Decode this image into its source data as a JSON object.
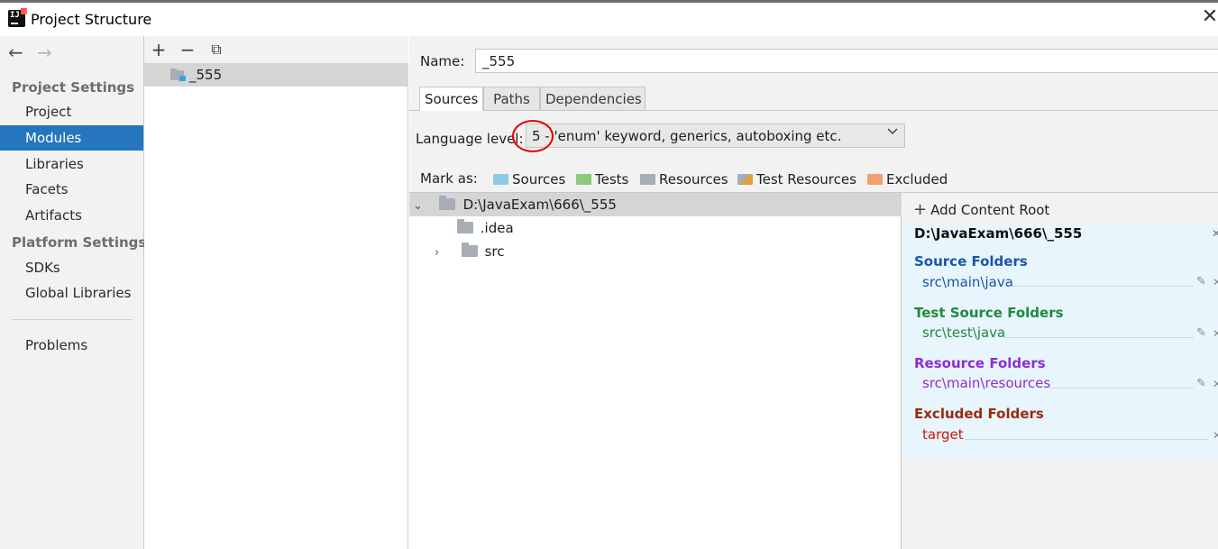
{
  "window": {
    "title": "Project Structure",
    "close_glyph": "✕"
  },
  "nav": {
    "back_glyph": "←",
    "forward_glyph": "→",
    "project_settings_header": "Project Settings",
    "project_settings_items": [
      "Project",
      "Modules",
      "Libraries",
      "Facets",
      "Artifacts"
    ],
    "platform_settings_header": "Platform Settings",
    "platform_settings_items": [
      "SDKs",
      "Global Libraries"
    ],
    "problems": "Problems",
    "selected": "Modules"
  },
  "modules": {
    "toolbar": {
      "add": "+",
      "remove": "−",
      "copy": "⧉"
    },
    "items": [
      "_555"
    ]
  },
  "module_detail": {
    "name_label": "Name:",
    "name_value": "_555",
    "tabs": [
      "Sources",
      "Paths",
      "Dependencies"
    ],
    "active_tab": "Sources",
    "language_level_label": "Language level:",
    "language_level_value": "5 - 'enum' keyword, generics, autoboxing etc.",
    "mark_as_label": "Mark as:",
    "mark_as": [
      {
        "label": "Sources",
        "color": "#8ccbe8"
      },
      {
        "label": "Tests",
        "color": "#8cc97c"
      },
      {
        "label": "Resources",
        "color": "#a6adb5"
      },
      {
        "label": "Test Resources",
        "color": "#a6adb5"
      },
      {
        "label": "Excluded",
        "color": "#f1a170"
      }
    ]
  },
  "tree": {
    "root": "D:\\JavaExam\\666\\_555",
    "children": [
      ".idea",
      "src"
    ]
  },
  "content_root": {
    "add_label": "Add Content Root",
    "path": "D:\\JavaExam\\666\\_555",
    "groups": [
      {
        "title": "Source Folders",
        "item": "src\\main\\java",
        "color": "#1a56a6"
      },
      {
        "title": "Test Source Folders",
        "item": "src\\test\\java",
        "color": "#1d8a3e"
      },
      {
        "title": "Resource Folders",
        "item": "src\\main\\resources",
        "color": "#8a2fd2"
      },
      {
        "title": "Excluded Folders",
        "item": "target",
        "title_color": "#9a2a0e",
        "color": "#d1140f"
      }
    ]
  }
}
